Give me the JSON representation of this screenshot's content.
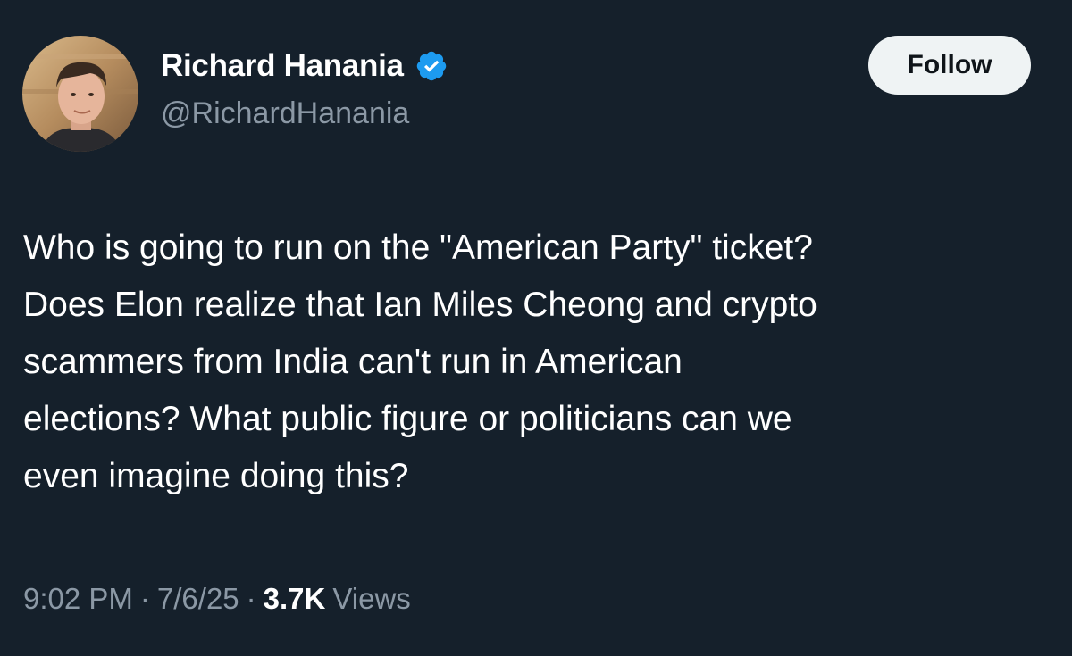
{
  "author": {
    "display_name": "Richard Hanania",
    "handle": "@RichardHanania",
    "verified": true
  },
  "actions": {
    "follow_label": "Follow"
  },
  "tweet": {
    "lines": [
      "Who is going to run on the \"American Party\" ticket?",
      "Does Elon realize that Ian Miles Cheong and crypto",
      "scammers from India can't run in American",
      "elections? What public figure or politicians can we",
      "even imagine doing this?"
    ]
  },
  "meta": {
    "time": "9:02 PM",
    "separator": "·",
    "date": "7/6/25",
    "views_count": "3.7K",
    "views_label": "Views"
  },
  "colors": {
    "background": "#15202b",
    "text_primary": "#ffffff",
    "text_secondary": "#8b98a5",
    "verified_badge": "#1d9bf0",
    "follow_bg": "#eff3f4"
  },
  "icons": {
    "verified": "verified-badge-icon",
    "avatar": "profile-photo"
  }
}
